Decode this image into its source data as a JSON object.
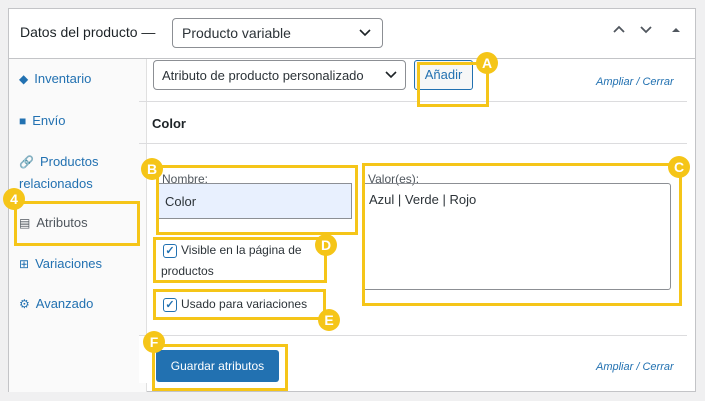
{
  "header": {
    "title": "Datos del producto —",
    "product_type": "Producto variable",
    "up_icon": "chevron-up-icon",
    "down_icon": "chevron-down-icon",
    "collapse_icon": "triangle-up-icon"
  },
  "sidebar": {
    "items": [
      {
        "label": "Inventario",
        "icon": "tag-icon"
      },
      {
        "label": "Envío",
        "icon": "truck-icon"
      },
      {
        "label": "Productos relacionados",
        "icon": "link-icon"
      },
      {
        "label": "Atributos",
        "icon": "list-icon"
      },
      {
        "label": "Variaciones",
        "icon": "grid-icon"
      },
      {
        "label": "Avanzado",
        "icon": "gear-icon"
      }
    ]
  },
  "toolbar": {
    "attribute_select": "Atributo de producto personalizado",
    "add_label": "Añadir",
    "expand": "Ampliar",
    "sep": "/",
    "close": "Cerrar"
  },
  "attribute": {
    "heading": "Color",
    "name_label": "Nombre:",
    "name_value": "Color",
    "values_label": "Valor(es):",
    "values": "Azul | Verde | Rojo",
    "visible_label_1": "Visible en la página de",
    "visible_label_2": "productos",
    "visible_checked": true,
    "variations_label": "Usado para variaciones",
    "variations_checked": true
  },
  "footer": {
    "save_label": "Guardar atributos",
    "expand": "Ampliar",
    "sep": "/",
    "close": "Cerrar"
  },
  "annotations": {
    "highlight_color": "#f5c518",
    "badges": [
      "A",
      "B",
      "C",
      "D",
      "E",
      "F",
      "4"
    ]
  }
}
